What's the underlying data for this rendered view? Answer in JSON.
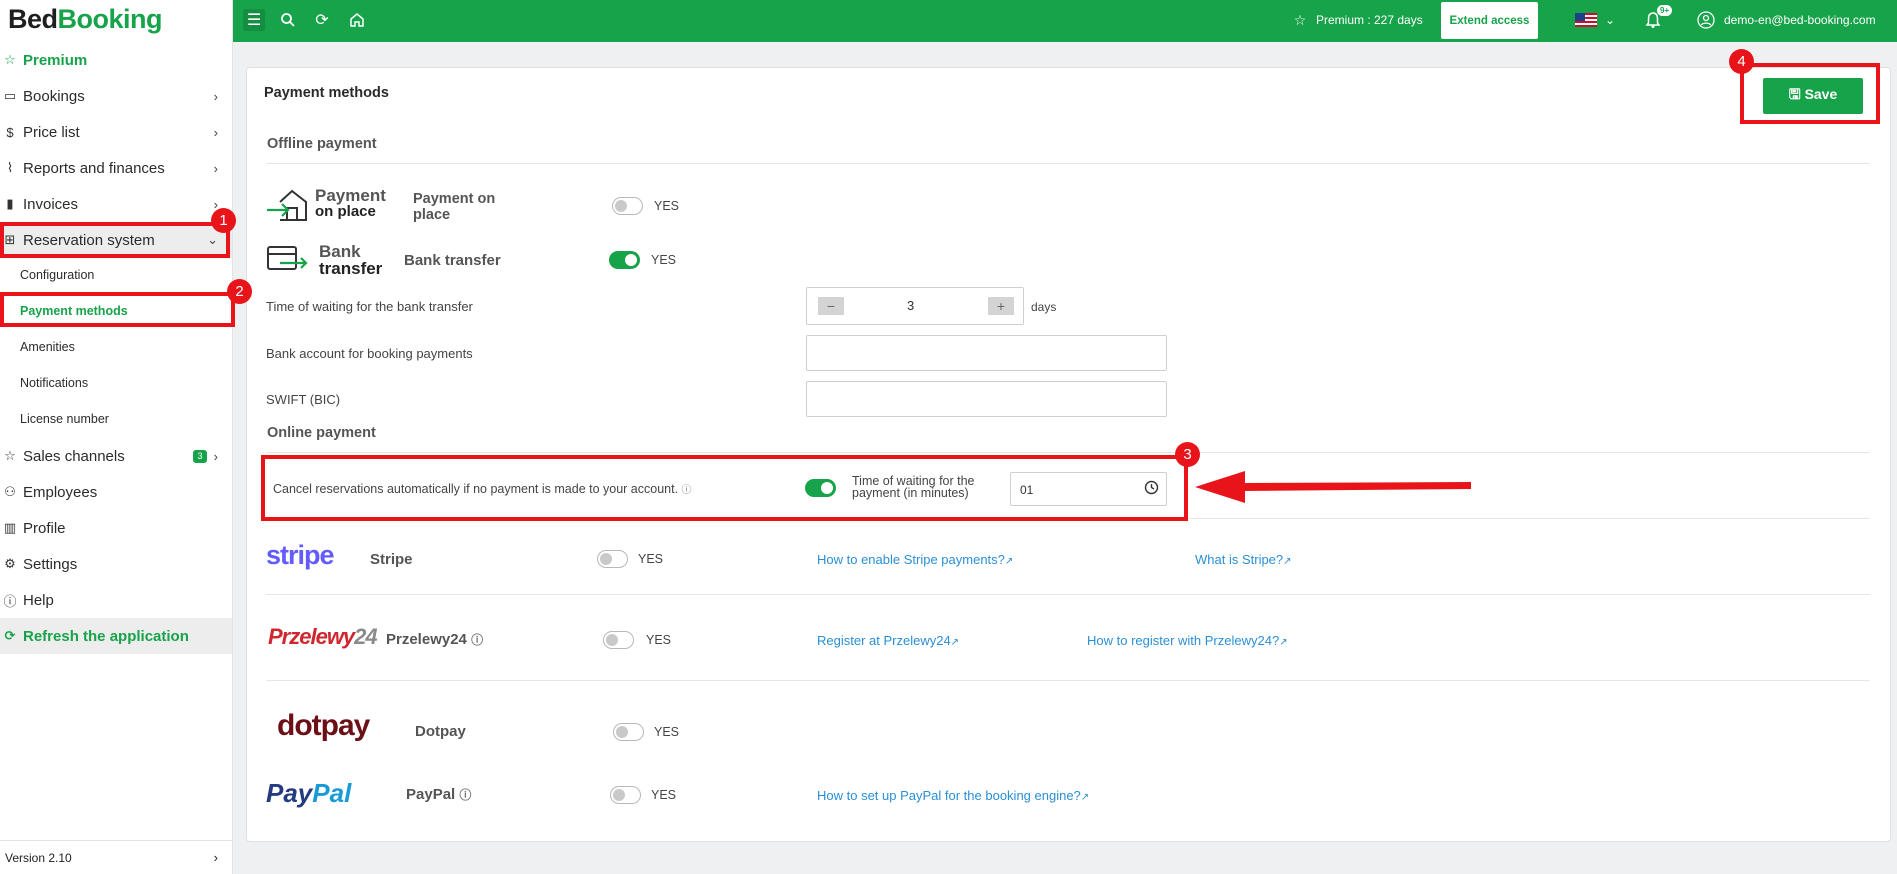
{
  "brand": {
    "part1": "Bed",
    "part2": "Booking"
  },
  "colors": {
    "accent": "#17a34a",
    "annotation": "#e8141a",
    "link": "#2b8fd6"
  },
  "sidebar": {
    "premium": "Premium",
    "items": [
      {
        "label": "Bookings",
        "icon": "calendar-icon"
      },
      {
        "label": "Price list",
        "icon": "dollar-icon"
      },
      {
        "label": "Reports and finances",
        "icon": "chart-icon"
      },
      {
        "label": "Invoices",
        "icon": "invoice-icon"
      },
      {
        "label": "Reservation system",
        "icon": "grid-icon"
      }
    ],
    "subitems": [
      "Configuration",
      "Payment methods",
      "Amenities",
      "Notifications",
      "License number"
    ],
    "items2": [
      {
        "label": "Sales channels",
        "icon": "star-icon",
        "badge": "3"
      },
      {
        "label": "Employees",
        "icon": "user-plus-icon"
      },
      {
        "label": "Profile",
        "icon": "building-icon"
      },
      {
        "label": "Settings",
        "icon": "gear-icon"
      },
      {
        "label": "Help",
        "icon": "info-icon"
      }
    ],
    "refresh": "Refresh the application",
    "version": "Version 2.10"
  },
  "topbar": {
    "premium_status": "Premium : 227 days",
    "extend_access": "Extend access",
    "notifications_badge": "9+",
    "user_email": "demo-en@bed-booking.com"
  },
  "main": {
    "title": "Payment methods",
    "save": "Save",
    "offline_title": "Offline payment",
    "online_title": "Online payment",
    "yes": "YES",
    "payment_on_place": {
      "logo_line1": "Payment",
      "logo_line2": "on place",
      "name_line1": "Payment on",
      "name_line2": "place",
      "enabled": false
    },
    "bank_transfer": {
      "logo_line1": "Bank",
      "logo_line2": "transfer",
      "name": "Bank transfer",
      "enabled": true
    },
    "waiting_label": "Time of waiting for the bank transfer",
    "waiting_value": "3",
    "waiting_unit": "days",
    "bank_account_label": "Bank account for booking payments",
    "swift_label": "SWIFT (BIC)",
    "cancel_label": "Cancel reservations automatically if no payment is made to your account.",
    "cancel_enabled": true,
    "payment_wait_label_line1": "Time of waiting for the",
    "payment_wait_label_line2": "payment (in minutes)",
    "payment_wait_value": "01",
    "stripe": {
      "logo": "stripe",
      "name": "Stripe",
      "link1": "How to enable Stripe payments?",
      "link2": "What is Stripe?",
      "enabled": false
    },
    "przelewy24": {
      "logo1": "Przelewy",
      "logo2": "24",
      "name": "Przelewy24",
      "link1": "Register at Przelewy24",
      "link2": "How to register with Przelewy24?",
      "enabled": false
    },
    "dotpay": {
      "logo": "dotpay",
      "name": "Dotpay",
      "enabled": false
    },
    "paypal": {
      "logo1": "Pay",
      "logo2": "Pal",
      "name": "PayPal",
      "link1": "How to set up PayPal for the booking engine?",
      "enabled": false
    }
  },
  "annotations": [
    "1",
    "2",
    "3",
    "4"
  ]
}
